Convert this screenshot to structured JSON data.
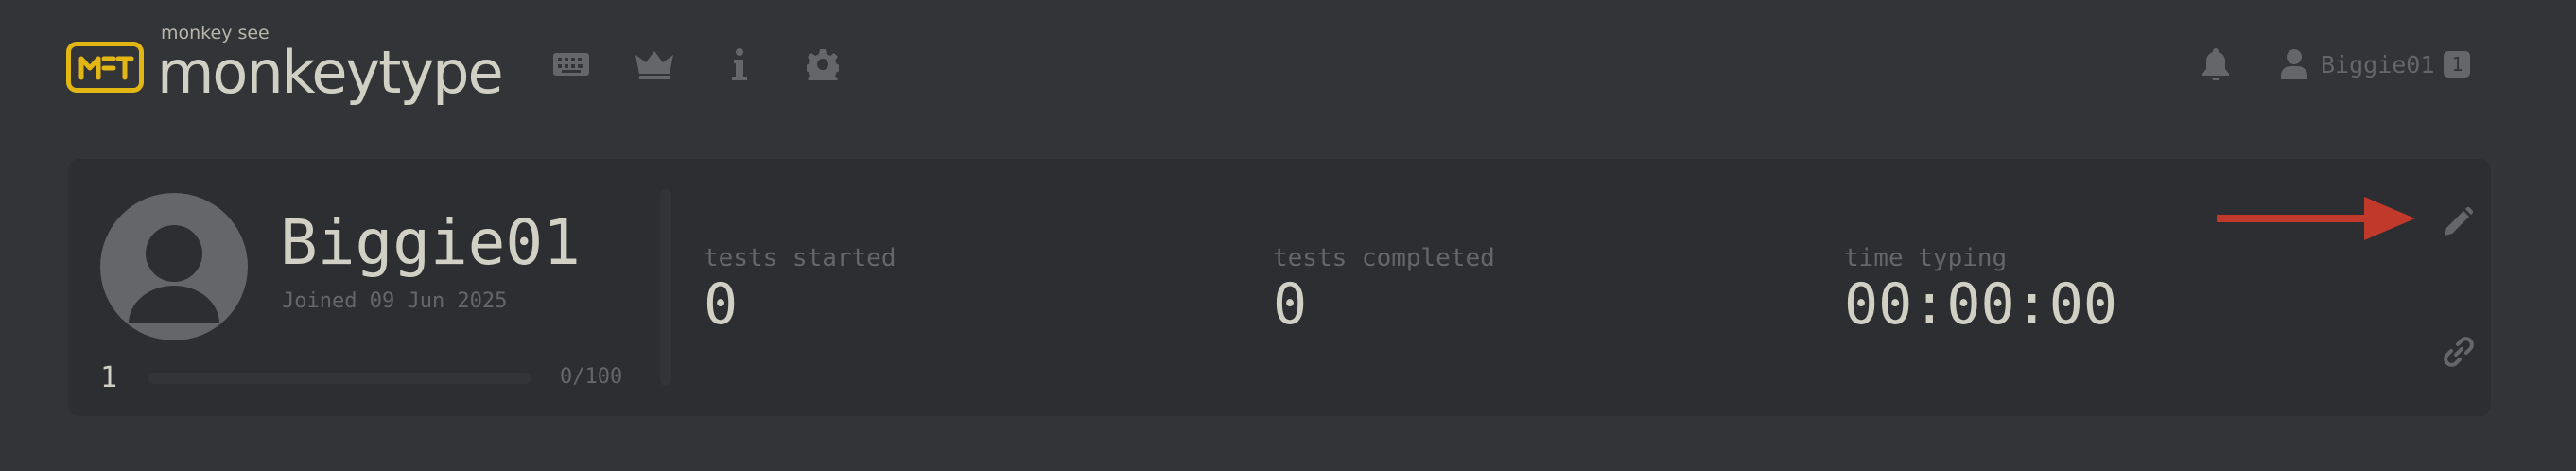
{
  "header": {
    "logo_subtitle": "monkey see",
    "logo_title": "monkeytype",
    "nav": [
      "keyboard-icon",
      "crown-icon",
      "info-icon",
      "gear-icon"
    ],
    "account": {
      "username": "Biggie01",
      "level": "1"
    }
  },
  "profile": {
    "username": "Biggie01",
    "joined": "Joined 09 Jun 2025",
    "level": "1",
    "xp_text": "0/100",
    "xp_progress": 0,
    "stats": [
      {
        "label": "tests started",
        "value": "0"
      },
      {
        "label": "tests completed",
        "value": "0"
      },
      {
        "label": "time typing",
        "value": "00:00:00"
      }
    ]
  },
  "colors": {
    "background": "#323437",
    "card": "#2c2e31",
    "accent": "#e2b714",
    "text": "#d1d0c5",
    "sub": "#646669",
    "annotation_arrow": "#c0392b"
  }
}
